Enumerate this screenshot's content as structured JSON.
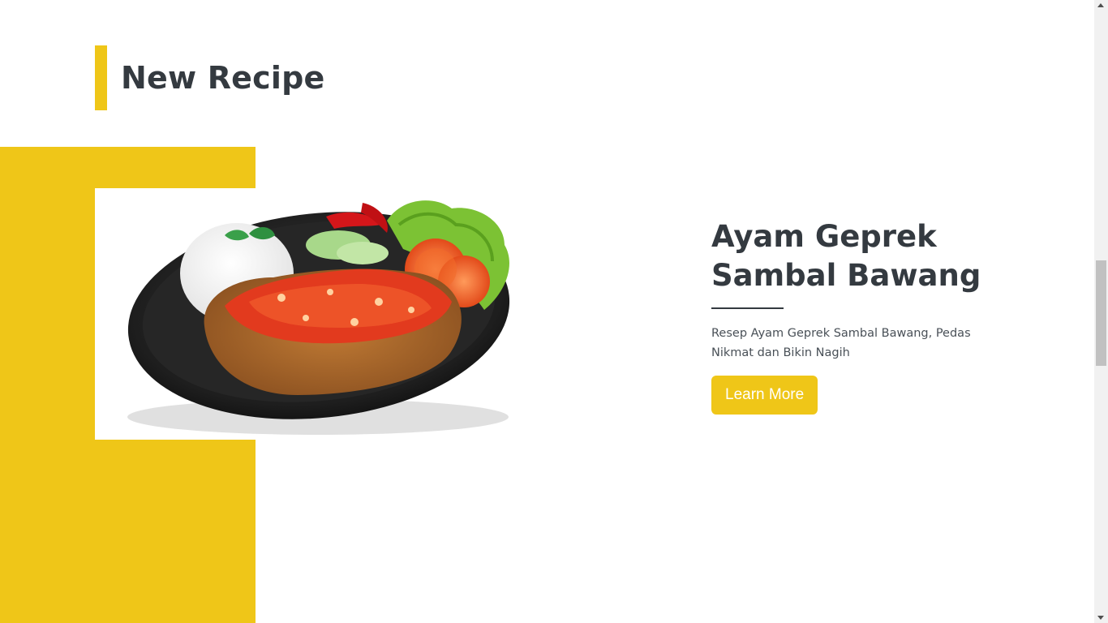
{
  "section": {
    "title": "New Recipe"
  },
  "recipe": {
    "title": "Ayam Geprek Sambal Bawang",
    "description": "Resep Ayam Geprek Sambal Bawang, Pedas Nikmat dan Bikin Nagih",
    "button_label": "Learn More",
    "image_icon": "fried-chicken-plate-image"
  },
  "colors": {
    "accent": "#efc618",
    "text_dark": "#343a40",
    "text_body": "#495057",
    "background": "#ffffff"
  },
  "icons": {
    "scroll_up": "chevron-up-icon",
    "scroll_down": "chevron-down-icon"
  }
}
